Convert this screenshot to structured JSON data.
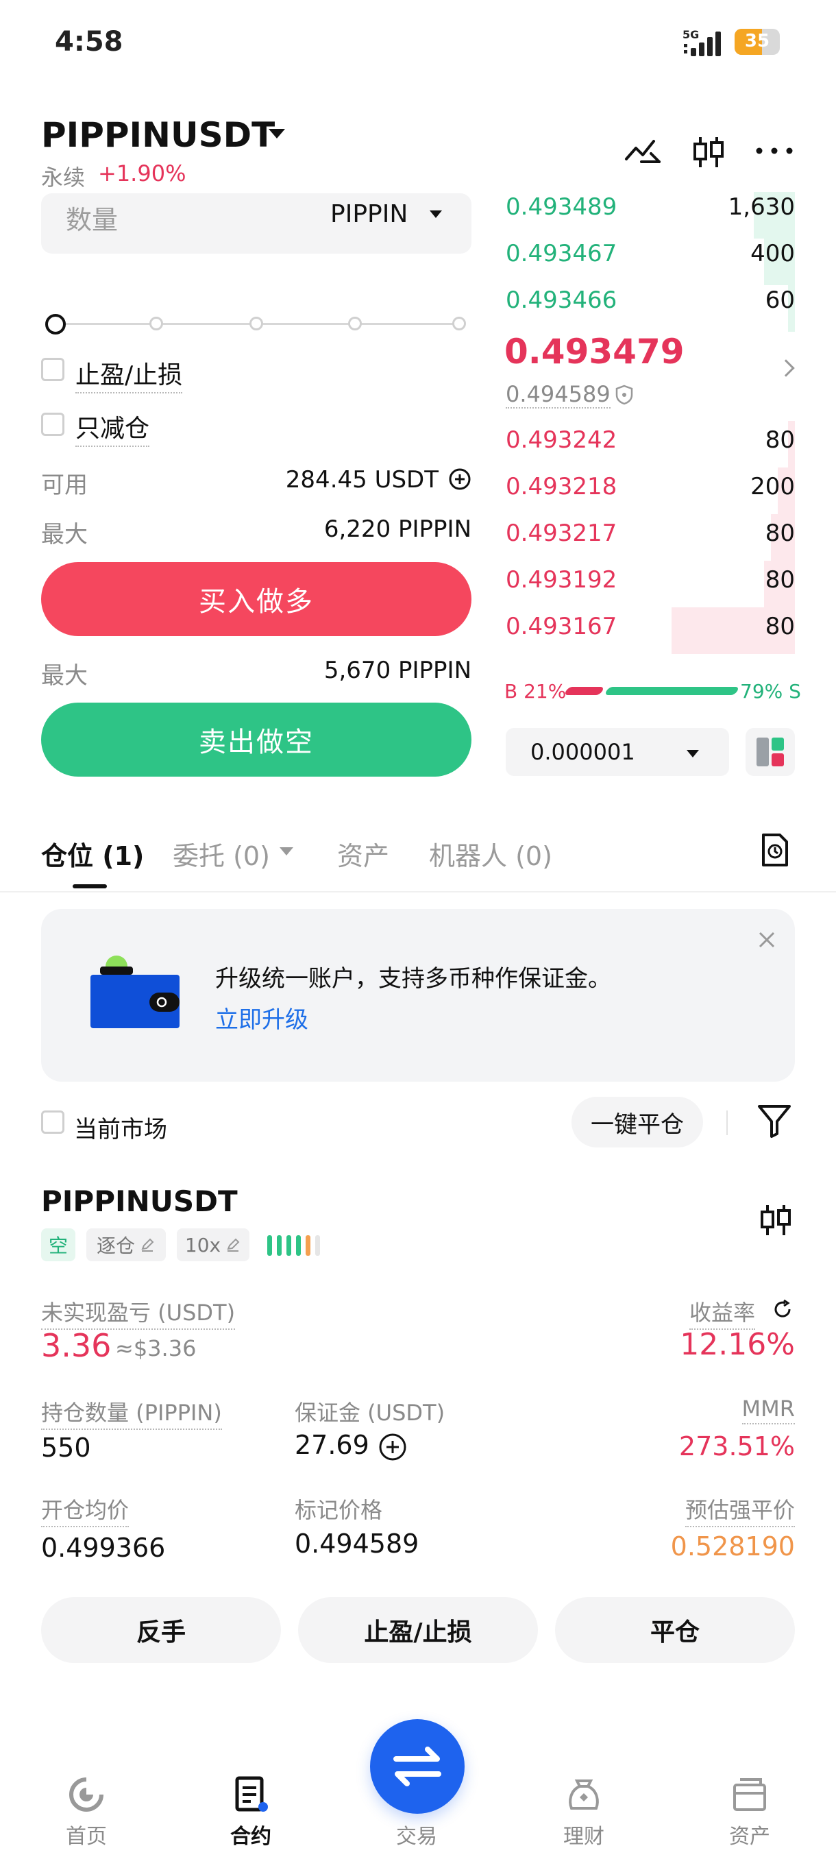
{
  "status": {
    "time": "4:58",
    "network": "5G",
    "battery": "35"
  },
  "header": {
    "symbol": "PIPPINUSDT",
    "type": "永续",
    "change": "+1.90%"
  },
  "form": {
    "quantity_label": "数量",
    "quantity_unit": "PIPPIN",
    "tp_sl_label": "止盈/止损",
    "reduce_only_label": "只减仓",
    "available_label": "可用",
    "available_value": "284.45 USDT",
    "max_buy_label": "最大",
    "max_buy_value": "6,220 PIPPIN",
    "buy_button": "买入做多",
    "max_sell_label": "最大",
    "max_sell_value": "5,670 PIPPIN",
    "sell_button": "卖出做空"
  },
  "orderbook": {
    "asks": [
      {
        "price": "0.493489",
        "qty": "1,630",
        "depth": 0.12
      },
      {
        "price": "0.493467",
        "qty": "400",
        "depth": 0.09
      },
      {
        "price": "0.493466",
        "qty": "60",
        "depth": 0.02
      }
    ],
    "mid_price": "0.493479",
    "mark_price": "0.494589",
    "bids": [
      {
        "price": "0.493242",
        "qty": "80",
        "depth": 0.02
      },
      {
        "price": "0.493218",
        "qty": "200",
        "depth": 0.05
      },
      {
        "price": "0.493217",
        "qty": "80",
        "depth": 0.07
      },
      {
        "price": "0.493192",
        "qty": "80",
        "depth": 0.09
      },
      {
        "price": "0.493167",
        "qty": "80",
        "depth": 0.36
      }
    ],
    "buy_ratio_label": "B 21%",
    "sell_ratio_label": "79% S",
    "buy_ratio": 0.21,
    "precision": "0.000001"
  },
  "tabs": {
    "positions": "仓位 (1)",
    "orders": "委托 (0)",
    "assets": "资产",
    "bots": "机器人 (0)"
  },
  "banner": {
    "text": "升级统一账户，支持多币种作保证金。",
    "link": "立即升级"
  },
  "filter": {
    "current_market": "当前市场",
    "close_all": "一键平仓"
  },
  "position": {
    "symbol": "PIPPINUSDT",
    "side": "空",
    "margin_mode": "逐仓",
    "leverage": "10x",
    "unrealized_pnl_label": "未实现盈亏 (USDT)",
    "unrealized_pnl": "3.36",
    "unrealized_pnl_approx": "≈$3.36",
    "roe_label": "收益率",
    "roe": "12.16%",
    "size_label": "持仓数量 (PIPPIN)",
    "size": "550",
    "margin_label": "保证金 (USDT)",
    "margin": "27.69",
    "mmr_label": "MMR",
    "mmr": "273.51%",
    "entry_label": "开仓均价",
    "entry": "0.499366",
    "mark_label": "标记价格",
    "mark": "0.494589",
    "liq_label": "预估强平价",
    "liq": "0.528190",
    "buttons": {
      "reverse": "反手",
      "tp_sl": "止盈/止损",
      "close": "平仓"
    }
  },
  "nav": {
    "home": "首页",
    "futures": "合约",
    "trade": "交易",
    "earn": "理财",
    "assets": "资产"
  },
  "colors": {
    "buy": "#f5475e",
    "sell": "#2ec486",
    "ask_text": "#22b27a",
    "bid_text": "#e5345a",
    "accent": "#1e63ee",
    "liq": "#f0954a"
  }
}
